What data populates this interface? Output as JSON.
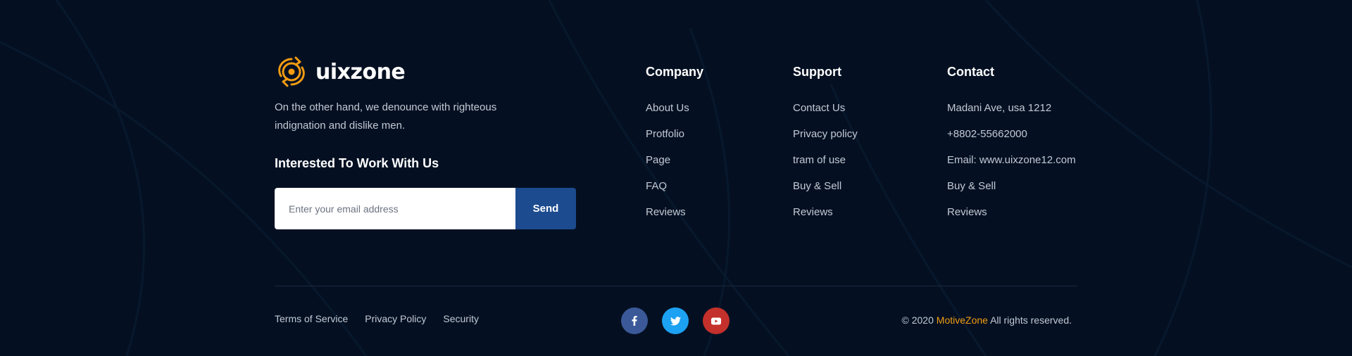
{
  "brand": {
    "name": "uixzone",
    "description": "On the other hand, we denounce with righteous indignation and dislike men.",
    "accent_color": "#f39c12"
  },
  "subscribe": {
    "title": "Interested To Work With Us",
    "placeholder": "Enter your email address",
    "button_label": "Send",
    "button_color": "#1c4b8f"
  },
  "columns": {
    "company": {
      "title": "Company",
      "items": [
        "About Us",
        "Protfolio",
        "Page",
        "FAQ",
        "Reviews"
      ]
    },
    "support": {
      "title": "Support",
      "items": [
        "Contact Us",
        "Privacy policy",
        "tram of use",
        "Buy & Sell",
        "Reviews"
      ]
    },
    "contact": {
      "title": "Contact",
      "items": [
        "Madani Ave, usa 1212",
        "+8802-55662000",
        "Email: www.uixzone12.com",
        "Buy & Sell",
        "Reviews"
      ]
    }
  },
  "legal_links": [
    "Terms of Service",
    "Privacy Policy",
    "Security"
  ],
  "socials": [
    {
      "icon": "facebook-icon",
      "color": "#3b5998"
    },
    {
      "icon": "twitter-icon",
      "color": "#1da1f2"
    },
    {
      "icon": "youtube-icon",
      "color": "#c4302b"
    }
  ],
  "copyright": {
    "prefix": "© 2020",
    "brand": "MotiveZone",
    "suffix": "All rights reserved."
  },
  "colors": {
    "background": "#041022",
    "text": "#c3c9d4"
  }
}
